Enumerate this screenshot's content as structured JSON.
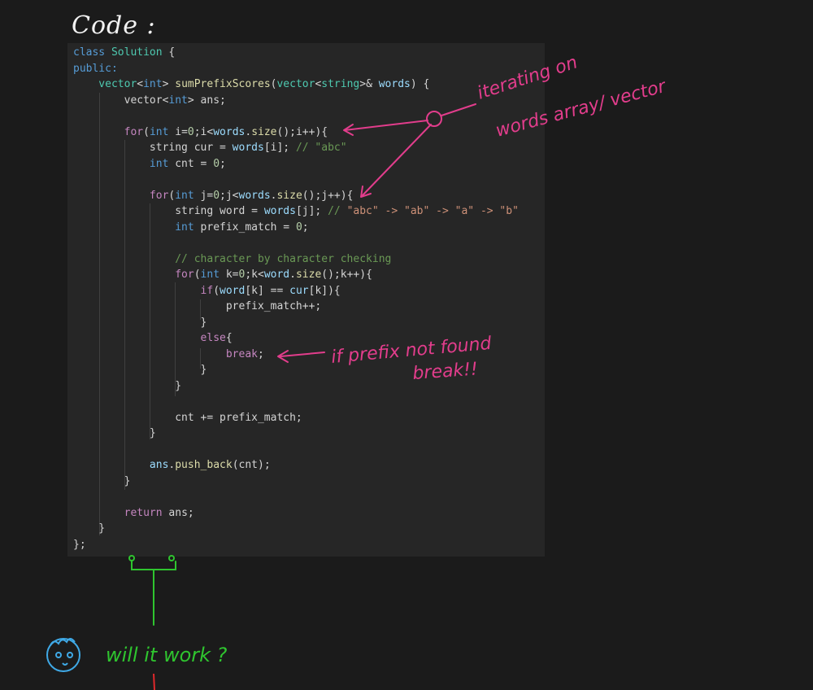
{
  "heading": "Code :",
  "colors": {
    "background": "#1b1b1b",
    "panel": "#262626",
    "annotation_pink": "#e23d8c",
    "annotation_green": "#2fc52f",
    "annotation_blue": "#3fa9e6",
    "annotation_red": "#e0282b"
  },
  "code_lines": [
    [
      {
        "t": "class ",
        "c": "kw"
      },
      {
        "t": "Solution",
        "c": "ty"
      },
      {
        "t": " {",
        "c": "plain"
      }
    ],
    [
      {
        "t": "public:",
        "c": "kw"
      }
    ],
    [
      {
        "t": "    vector",
        "c": "ty"
      },
      {
        "t": "<",
        "c": "plain"
      },
      {
        "t": "int",
        "c": "kw"
      },
      {
        "t": "> ",
        "c": "plain"
      },
      {
        "t": "sumPrefixScores",
        "c": "fn"
      },
      {
        "t": "(",
        "c": "plain"
      },
      {
        "t": "vector",
        "c": "ty"
      },
      {
        "t": "<",
        "c": "plain"
      },
      {
        "t": "string",
        "c": "ty"
      },
      {
        "t": ">& ",
        "c": "plain"
      },
      {
        "t": "words",
        "c": "var"
      },
      {
        "t": ") {",
        "c": "plain"
      }
    ],
    [
      {
        "t": "        vector",
        "c": "plain"
      },
      {
        "t": "<",
        "c": "plain"
      },
      {
        "t": "int",
        "c": "kw"
      },
      {
        "t": "> ans;",
        "c": "plain"
      }
    ],
    [
      {
        "t": "",
        "c": "plain"
      }
    ],
    [
      {
        "t": "        ",
        "c": "plain"
      },
      {
        "t": "for",
        "c": "ctl"
      },
      {
        "t": "(",
        "c": "plain"
      },
      {
        "t": "int",
        "c": "kw"
      },
      {
        "t": " i=",
        "c": "plain"
      },
      {
        "t": "0",
        "c": "num"
      },
      {
        "t": ";i<",
        "c": "plain"
      },
      {
        "t": "words",
        "c": "var"
      },
      {
        "t": ".",
        "c": "plain"
      },
      {
        "t": "size",
        "c": "fn"
      },
      {
        "t": "();i++){",
        "c": "plain"
      }
    ],
    [
      {
        "t": "            string cur = ",
        "c": "plain"
      },
      {
        "t": "words",
        "c": "var"
      },
      {
        "t": "[i]; ",
        "c": "plain"
      },
      {
        "t": "// \"abc\"",
        "c": "cmt"
      }
    ],
    [
      {
        "t": "            ",
        "c": "plain"
      },
      {
        "t": "int",
        "c": "kw"
      },
      {
        "t": " cnt = ",
        "c": "plain"
      },
      {
        "t": "0",
        "c": "num"
      },
      {
        "t": ";",
        "c": "plain"
      }
    ],
    [
      {
        "t": "",
        "c": "plain"
      }
    ],
    [
      {
        "t": "            ",
        "c": "plain"
      },
      {
        "t": "for",
        "c": "ctl"
      },
      {
        "t": "(",
        "c": "plain"
      },
      {
        "t": "int",
        "c": "kw"
      },
      {
        "t": " j=",
        "c": "plain"
      },
      {
        "t": "0",
        "c": "num"
      },
      {
        "t": ";j<",
        "c": "plain"
      },
      {
        "t": "words",
        "c": "var"
      },
      {
        "t": ".",
        "c": "plain"
      },
      {
        "t": "size",
        "c": "fn"
      },
      {
        "t": "();j++){",
        "c": "plain"
      }
    ],
    [
      {
        "t": "                string word = ",
        "c": "plain"
      },
      {
        "t": "words",
        "c": "var"
      },
      {
        "t": "[j]; ",
        "c": "plain"
      },
      {
        "t": "// ",
        "c": "cmt"
      },
      {
        "t": "\"abc\" -> \"ab\" -> \"a\" -> \"b\"",
        "c": "str"
      }
    ],
    [
      {
        "t": "                ",
        "c": "plain"
      },
      {
        "t": "int",
        "c": "kw"
      },
      {
        "t": " prefix_match = ",
        "c": "plain"
      },
      {
        "t": "0",
        "c": "num"
      },
      {
        "t": ";",
        "c": "plain"
      }
    ],
    [
      {
        "t": "",
        "c": "plain"
      }
    ],
    [
      {
        "t": "                ",
        "c": "plain"
      },
      {
        "t": "// character by character checking",
        "c": "cmt"
      }
    ],
    [
      {
        "t": "                ",
        "c": "plain"
      },
      {
        "t": "for",
        "c": "ctl"
      },
      {
        "t": "(",
        "c": "plain"
      },
      {
        "t": "int",
        "c": "kw"
      },
      {
        "t": " k=",
        "c": "plain"
      },
      {
        "t": "0",
        "c": "num"
      },
      {
        "t": ";k<",
        "c": "plain"
      },
      {
        "t": "word",
        "c": "var"
      },
      {
        "t": ".",
        "c": "plain"
      },
      {
        "t": "size",
        "c": "fn"
      },
      {
        "t": "();k++){",
        "c": "plain"
      }
    ],
    [
      {
        "t": "                    ",
        "c": "plain"
      },
      {
        "t": "if",
        "c": "ctl"
      },
      {
        "t": "(",
        "c": "plain"
      },
      {
        "t": "word",
        "c": "var"
      },
      {
        "t": "[k] == ",
        "c": "plain"
      },
      {
        "t": "cur",
        "c": "var"
      },
      {
        "t": "[k]){",
        "c": "plain"
      }
    ],
    [
      {
        "t": "                        prefix_match++;",
        "c": "plain"
      }
    ],
    [
      {
        "t": "                    }",
        "c": "plain"
      }
    ],
    [
      {
        "t": "                    ",
        "c": "plain"
      },
      {
        "t": "else",
        "c": "ctl"
      },
      {
        "t": "{",
        "c": "plain"
      }
    ],
    [
      {
        "t": "                        ",
        "c": "plain"
      },
      {
        "t": "break",
        "c": "ctl"
      },
      {
        "t": ";",
        "c": "plain"
      }
    ],
    [
      {
        "t": "                    }",
        "c": "plain"
      }
    ],
    [
      {
        "t": "                }",
        "c": "plain"
      }
    ],
    [
      {
        "t": "",
        "c": "plain"
      }
    ],
    [
      {
        "t": "                cnt += prefix_match;",
        "c": "plain"
      }
    ],
    [
      {
        "t": "            }",
        "c": "plain"
      }
    ],
    [
      {
        "t": "",
        "c": "plain"
      }
    ],
    [
      {
        "t": "            ",
        "c": "plain"
      },
      {
        "t": "ans",
        "c": "var"
      },
      {
        "t": ".",
        "c": "plain"
      },
      {
        "t": "push_back",
        "c": "fn"
      },
      {
        "t": "(cnt);",
        "c": "plain"
      }
    ],
    [
      {
        "t": "        }",
        "c": "plain"
      }
    ],
    [
      {
        "t": "",
        "c": "plain"
      }
    ],
    [
      {
        "t": "        ",
        "c": "plain"
      },
      {
        "t": "return",
        "c": "ctl"
      },
      {
        "t": " ans;",
        "c": "plain"
      }
    ],
    [
      {
        "t": "    }",
        "c": "plain"
      }
    ],
    [
      {
        "t": "};",
        "c": "plain"
      }
    ]
  ],
  "annotations": {
    "iterating_line1": "iterating on",
    "iterating_line2": "words array/ vector",
    "prefix_line1": "if prefix not found",
    "prefix_line2": "break!!",
    "question": "will it work ?"
  }
}
